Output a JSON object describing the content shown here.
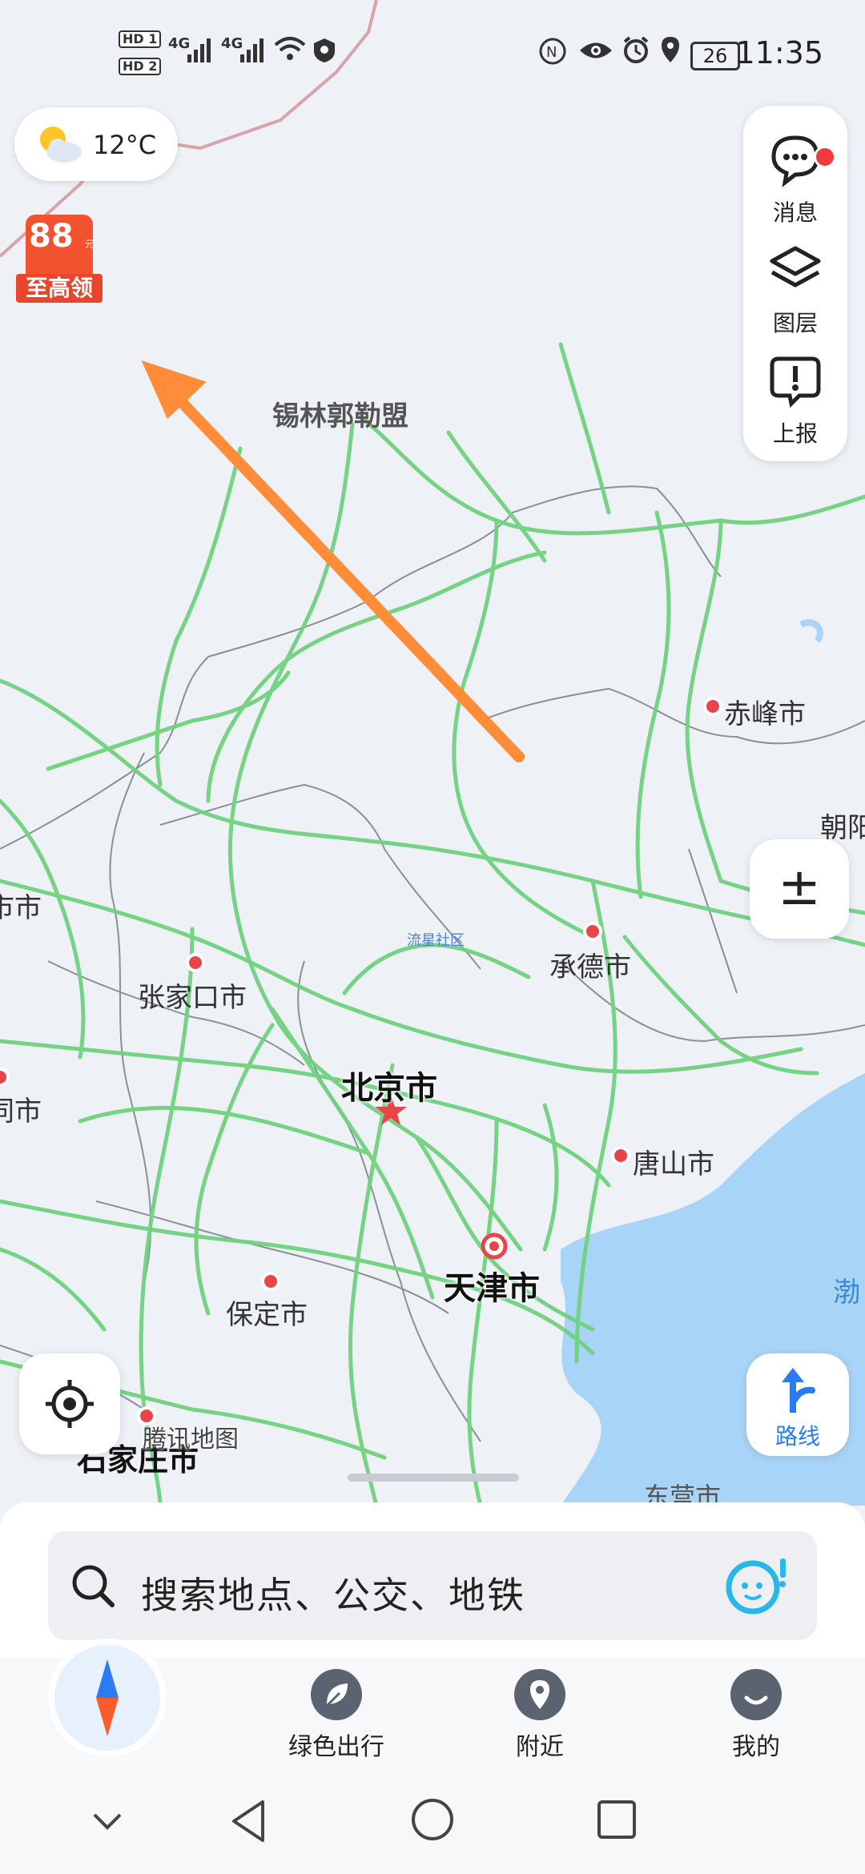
{
  "status_bar": {
    "time": "11:35",
    "battery": "26",
    "sim1": "HD",
    "sim1_num": "1",
    "sim2": "HD",
    "sim2_num": "2",
    "network1": "4G",
    "network2": "4G"
  },
  "weather": {
    "temperature": "12°C",
    "icon": "partly-cloudy-icon"
  },
  "promo": {
    "amount": "88",
    "unit": "元",
    "label": "至高领"
  },
  "right_panel": {
    "messages_label": "消息",
    "layers_label": "图层",
    "report_label": "上报"
  },
  "zoom": {
    "label": "±"
  },
  "route": {
    "label": "路线"
  },
  "map": {
    "watermark": "腾讯地图",
    "labels": {
      "xilinguole": "锡林郭勒盟",
      "chifeng": "赤峰市",
      "chaoyang": "朝阳",
      "left_city_1": "市市",
      "zhangjiakou": "张家口市",
      "liulizhi": "流星社区",
      "chengde": "承德市",
      "left_city_2": "同市",
      "beijing": "北京市",
      "tangshan": "唐山市",
      "tianjin": "天津市",
      "baoding": "保定市",
      "bohai": "渤",
      "shijiazhuang": "石家庄市",
      "dongying": "东营市"
    }
  },
  "search": {
    "placeholder": "搜索地点、公交、地铁"
  },
  "tabs": [
    {
      "label": "",
      "icon": "compass-icon"
    },
    {
      "label": "绿色出行",
      "icon": "leaf-icon"
    },
    {
      "label": "附近",
      "icon": "location-pin-icon"
    },
    {
      "label": "我的",
      "icon": "smile-icon"
    }
  ],
  "colors": {
    "road": "#6fd27d",
    "water": "#a8d4f7",
    "arrow": "#ff8c38",
    "city_dot": "#e8454a",
    "route_blue": "#2a7cf2"
  }
}
